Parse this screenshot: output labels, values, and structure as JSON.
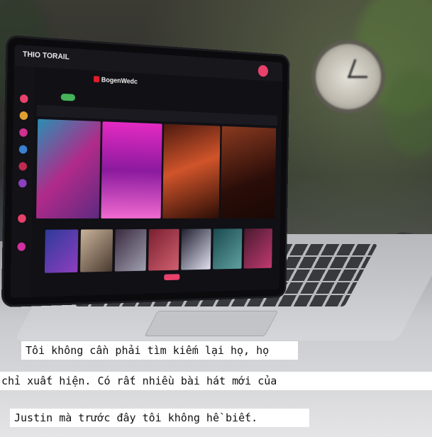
{
  "screen": {
    "app_logo_text": "THIO TORAIL",
    "brand_text": "BogenWedc"
  },
  "captions": [
    "Tôi không cần phải tìm kiếm lại họ, họ",
    "chỉ xuất hiện. Có rất nhiều bài hát mới của",
    "Justin mà trước đây tôi không hề biết."
  ],
  "colors": {
    "caption_bg": "#ffffff",
    "accent_pink": "#e8416b",
    "toggle_green": "#45b35a"
  }
}
